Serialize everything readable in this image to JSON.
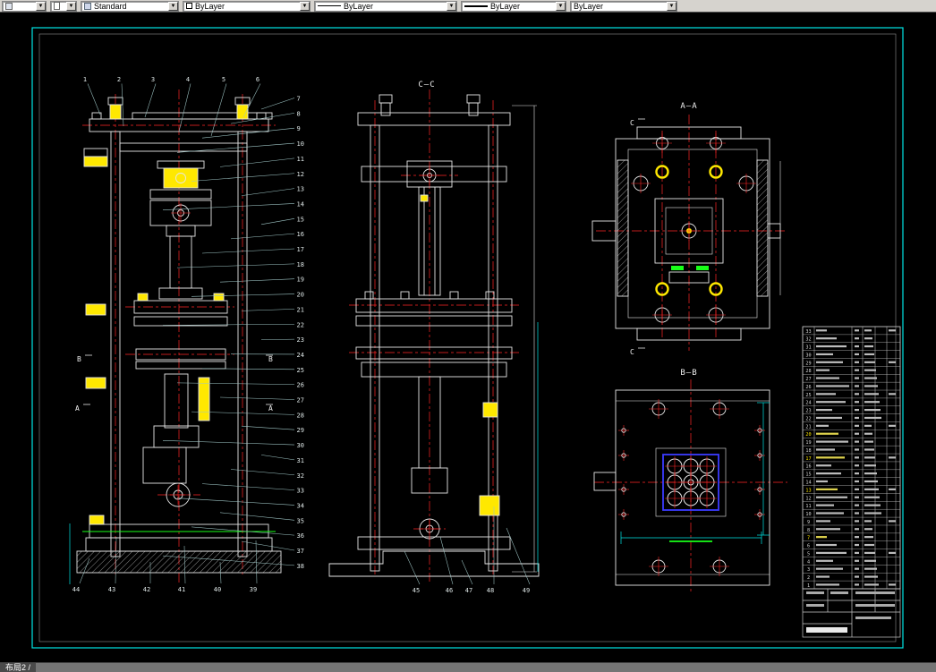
{
  "colors": {
    "canvas_bg": "#000000",
    "frame": "#00e5e5",
    "line": "#e6e6e6",
    "centerline": "#ff2626",
    "highlight": "#ffe800",
    "accent_blue": "#3b3bff",
    "accent_green": "#18ff18",
    "toolbar_bg": "#d6d3ce"
  },
  "toolbar": {
    "combos": [
      {
        "label": "",
        "icon": "named-view-icon"
      },
      {
        "label": "",
        "icon": "sheet-icon"
      },
      {
        "label": "Standard",
        "icon": "text-style-icon"
      },
      {
        "label": "ByLayer",
        "icon": "color-swatch-icon"
      },
      {
        "label": "ByLayer",
        "icon": "linetype-icon"
      },
      {
        "label": "ByLayer",
        "icon": "lineweight-icon"
      },
      {
        "label": "ByLayer",
        "icon": "plotstyle-icon"
      }
    ]
  },
  "statusbar": {
    "layout_label": "布局2 /"
  },
  "drawing": {
    "view_labels": {
      "cc": "C—C",
      "aa": "A—A",
      "bb": "B—B"
    },
    "section_marks": {
      "front_left_b": "B",
      "front_right_b": "B",
      "front_left_a": "A",
      "front_right_a": "A",
      "aa_top_c": "C",
      "aa_bottom_c": "C"
    },
    "callouts": {
      "top": [
        "1",
        "2",
        "3",
        "4",
        "5",
        "6"
      ],
      "right": [
        "7",
        "8",
        "9",
        "10",
        "11",
        "12",
        "13",
        "14",
        "15",
        "16",
        "17",
        "18",
        "19",
        "20",
        "21",
        "22",
        "23",
        "24",
        "25",
        "26",
        "27",
        "28",
        "29",
        "30",
        "31",
        "32",
        "33",
        "34",
        "35",
        "36",
        "37",
        "38"
      ],
      "bottom": [
        "44",
        "43",
        "42",
        "41",
        "40",
        "39"
      ],
      "cc_bottom": [
        "45",
        "46",
        "47",
        "48",
        "49"
      ]
    },
    "parts_table": {
      "rows": [
        {
          "no": "33"
        },
        {
          "no": "32"
        },
        {
          "no": "31"
        },
        {
          "no": "30"
        },
        {
          "no": "29"
        },
        {
          "no": "28"
        },
        {
          "no": "27"
        },
        {
          "no": "26"
        },
        {
          "no": "25"
        },
        {
          "no": "24"
        },
        {
          "no": "23"
        },
        {
          "no": "22"
        },
        {
          "no": "21"
        },
        {
          "no": "20",
          "highlight": true
        },
        {
          "no": "19"
        },
        {
          "no": "18"
        },
        {
          "no": "17",
          "highlight": true
        },
        {
          "no": "16"
        },
        {
          "no": "15"
        },
        {
          "no": "14"
        },
        {
          "no": "13",
          "highlight": true
        },
        {
          "no": "12"
        },
        {
          "no": "11"
        },
        {
          "no": "10"
        },
        {
          "no": "9"
        },
        {
          "no": "8"
        },
        {
          "no": "7",
          "highlight": true
        },
        {
          "no": "6"
        },
        {
          "no": "5"
        },
        {
          "no": "4"
        },
        {
          "no": "3"
        },
        {
          "no": "2"
        },
        {
          "no": "1"
        }
      ]
    }
  }
}
